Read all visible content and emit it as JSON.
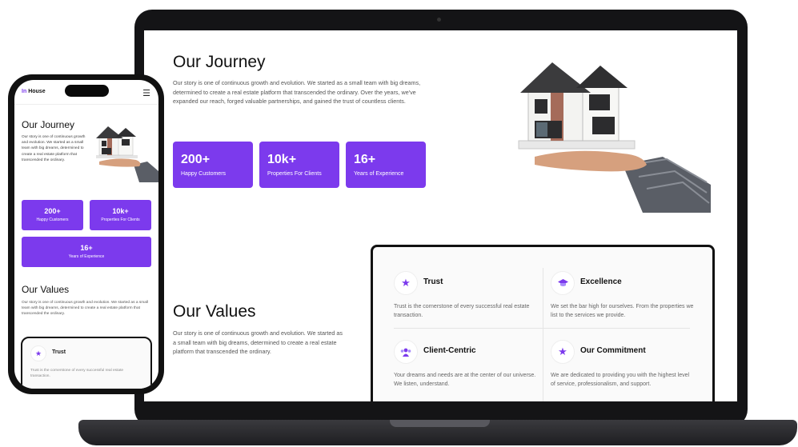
{
  "site": {
    "brand_prefix": "In",
    "brand_suffix": "House",
    "menu_icon": "hamburger-icon"
  },
  "journey": {
    "title": "Our Journey",
    "text": "Our story is one of continuous growth and evolution. We started as a small team with big dreams, determined to create a real estate platform that transcended the ordinary. Over the years, we've expanded our reach, forged valuable partnerships, and gained the trust of countless clients.",
    "mobile_text": "Our story is one of continuous growth and evolution. We started as a small team with big dreams, determined to create a real estate platform that transcended the ordinary.",
    "stats": [
      {
        "value": "200+",
        "label": "Happy Customers"
      },
      {
        "value": "10k+",
        "label": "Properties For Clients"
      },
      {
        "value": "16+",
        "label": "Years of Experience"
      }
    ]
  },
  "values": {
    "title": "Our Values",
    "text": "Our story is one of continuous growth and evolution. We started as a small team with big dreams, determined to create a real estate platform that transcended the ordinary.",
    "items": [
      {
        "icon": "star-icon",
        "name": "Trust",
        "desc": "Trust is the cornerstone of every successful real estate transaction."
      },
      {
        "icon": "graduation-cap-icon",
        "name": "Excellence",
        "desc": "We set the bar high for ourselves. From the properties we list to the services we provide."
      },
      {
        "icon": "users-icon",
        "name": "Client-Centric",
        "desc": "Your dreams and needs are at the center of our universe. We listen, understand."
      },
      {
        "icon": "star-icon",
        "name": "Our Commitment",
        "desc": "We are dedicated to providing you with the highest level of service, professionalism, and support."
      }
    ]
  },
  "colors": {
    "accent": "#7c3aed",
    "device_frame": "#141416"
  }
}
